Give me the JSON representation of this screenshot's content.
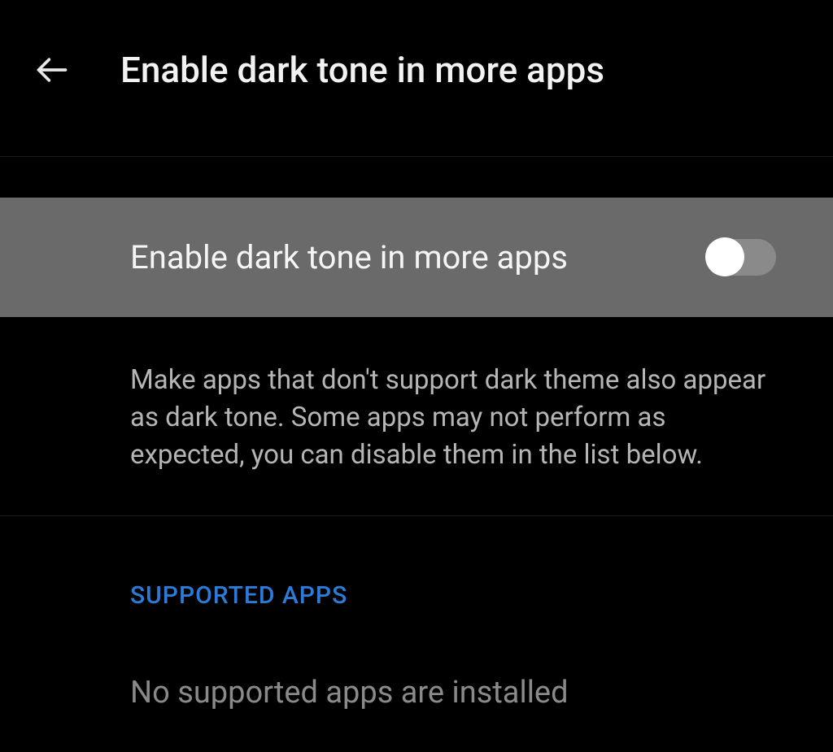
{
  "header": {
    "title": "Enable dark tone in more apps"
  },
  "toggle": {
    "label": "Enable dark tone in more apps",
    "enabled": false
  },
  "description": "Make apps that don't support dark theme also appear as dark tone. Some apps may not perform as expected, you can disable them in the list below.",
  "section": {
    "title": "SUPPORTED APPS",
    "empty_message": "No supported apps are installed"
  }
}
